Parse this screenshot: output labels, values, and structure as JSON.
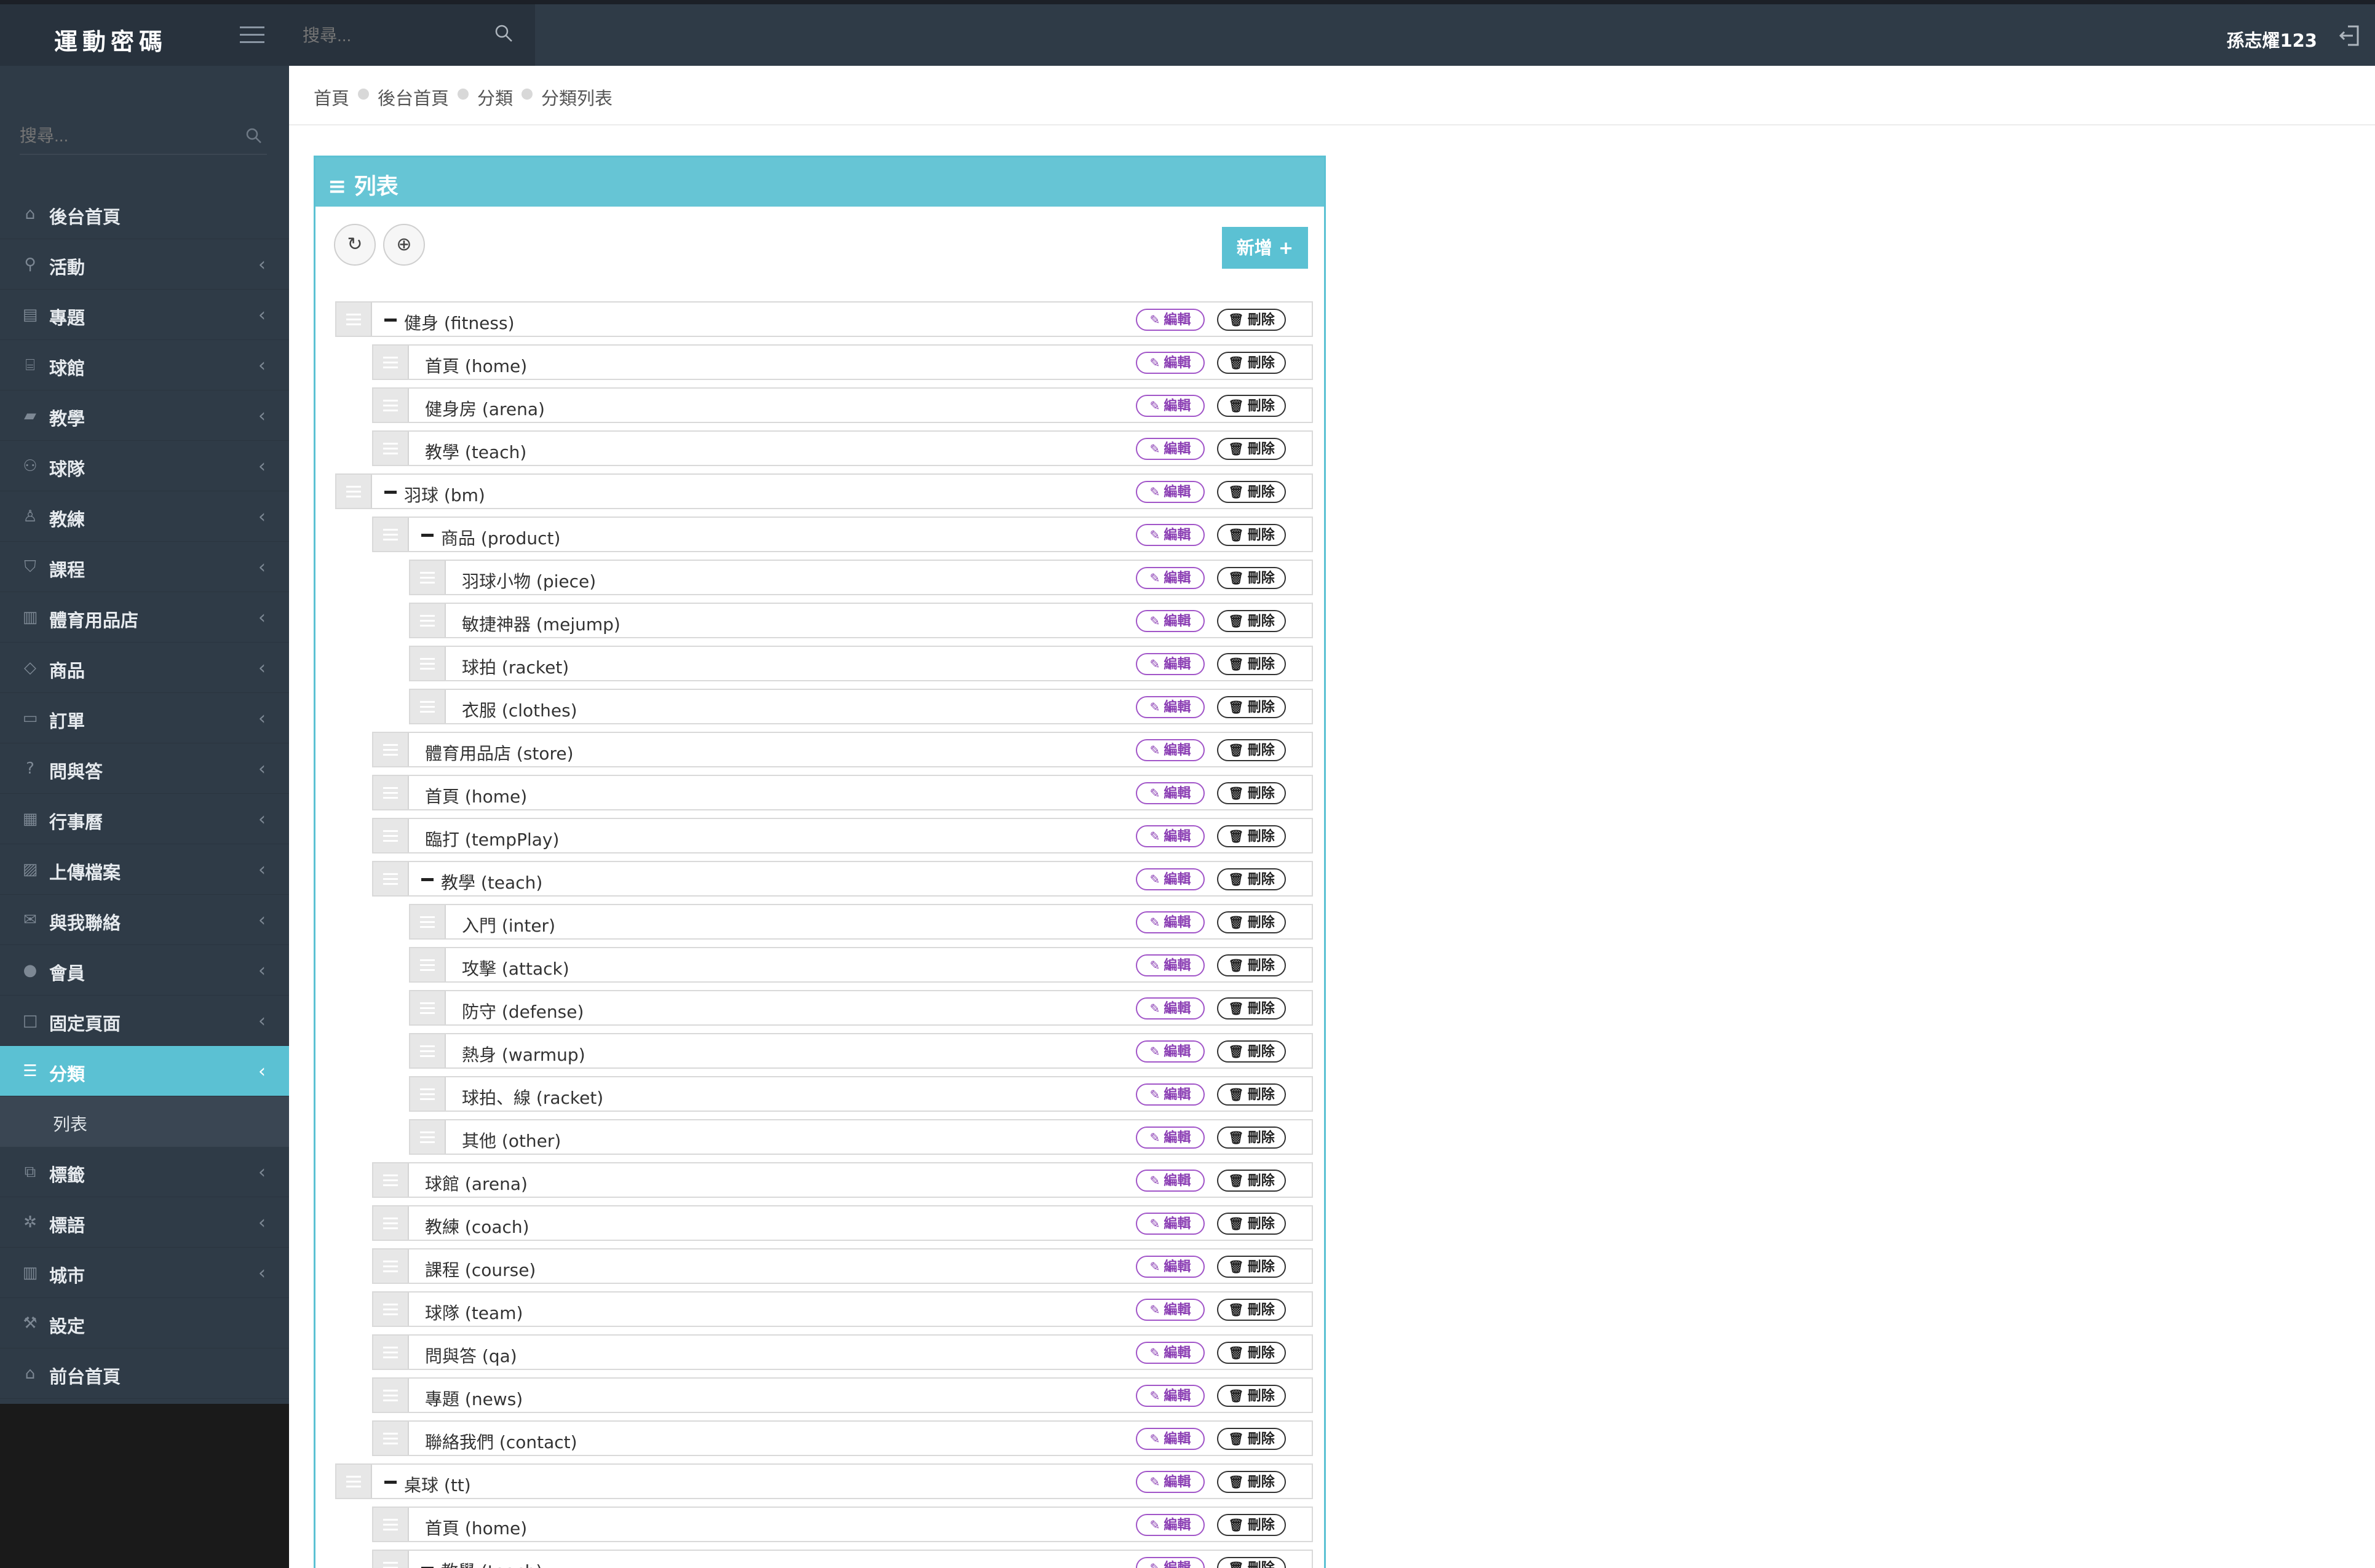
{
  "app": {
    "logo": "運動密碼",
    "search_placeholder": "搜尋...",
    "sidebar_search_placeholder": "搜尋...",
    "user_name": "孫志燿123"
  },
  "sidebar": {
    "items": [
      {
        "label": "後台首頁",
        "icon": "home-icon",
        "chevron": false
      },
      {
        "label": "活動",
        "icon": "bicycle-icon",
        "chevron": true
      },
      {
        "label": "專題",
        "icon": "newspaper-icon",
        "chevron": true
      },
      {
        "label": "球館",
        "icon": "bank-icon",
        "chevron": true
      },
      {
        "label": "教學",
        "icon": "book-icon",
        "chevron": true
      },
      {
        "label": "球隊",
        "icon": "users-icon",
        "chevron": true
      },
      {
        "label": "教練",
        "icon": "person-icon",
        "chevron": true
      },
      {
        "label": "課程",
        "icon": "graduation-cap-icon",
        "chevron": true
      },
      {
        "label": "體育用品店",
        "icon": "building-icon",
        "chevron": true
      },
      {
        "label": "商品",
        "icon": "diamond-icon",
        "chevron": true
      },
      {
        "label": "訂單",
        "icon": "desktop-icon",
        "chevron": true
      },
      {
        "label": "問與答",
        "icon": "question-icon",
        "chevron": true
      },
      {
        "label": "行事曆",
        "icon": "calendar-icon",
        "chevron": true
      },
      {
        "label": "上傳檔案",
        "icon": "image-icon",
        "chevron": true
      },
      {
        "label": "與我聯絡",
        "icon": "envelope-icon",
        "chevron": true
      },
      {
        "label": "會員",
        "icon": "user-icon",
        "chevron": true
      },
      {
        "label": "固定頁面",
        "icon": "square-icon",
        "chevron": true
      },
      {
        "label": "分類",
        "icon": "list-icon",
        "chevron": true,
        "active": true
      },
      {
        "label": "標籤",
        "icon": "tags-icon",
        "chevron": true
      },
      {
        "label": "標語",
        "icon": "gear-icon",
        "chevron": true
      },
      {
        "label": "城市",
        "icon": "building-icon",
        "chevron": true
      },
      {
        "label": "設定",
        "icon": "wrench-icon",
        "chevron": false
      },
      {
        "label": "前台首頁",
        "icon": "home-icon",
        "chevron": false
      }
    ],
    "submenu": {
      "label": "列表"
    }
  },
  "breadcrumb": [
    "首頁",
    "後台首頁",
    "分類",
    "分類列表"
  ],
  "panel": {
    "title": "列表",
    "add_label": "新增",
    "edit_label": "編輯",
    "delete_label": "刪除"
  },
  "tree": [
    {
      "label": "健身 (fitness)",
      "level": 0,
      "collapsible": true
    },
    {
      "label": "首頁 (home)",
      "level": 1,
      "collapsible": false
    },
    {
      "label": "健身房 (arena)",
      "level": 1,
      "collapsible": false
    },
    {
      "label": "教學 (teach)",
      "level": 1,
      "collapsible": false
    },
    {
      "label": "羽球 (bm)",
      "level": 0,
      "collapsible": true
    },
    {
      "label": "商品 (product)",
      "level": 1,
      "collapsible": true
    },
    {
      "label": "羽球小物 (piece)",
      "level": 2,
      "collapsible": false
    },
    {
      "label": "敏捷神器 (mejump)",
      "level": 2,
      "collapsible": false
    },
    {
      "label": "球拍 (racket)",
      "level": 2,
      "collapsible": false
    },
    {
      "label": "衣服 (clothes)",
      "level": 2,
      "collapsible": false
    },
    {
      "label": "體育用品店 (store)",
      "level": 1,
      "collapsible": false
    },
    {
      "label": "首頁 (home)",
      "level": 1,
      "collapsible": false
    },
    {
      "label": "臨打 (tempPlay)",
      "level": 1,
      "collapsible": false
    },
    {
      "label": "教學 (teach)",
      "level": 1,
      "collapsible": true
    },
    {
      "label": "入門 (inter)",
      "level": 2,
      "collapsible": false
    },
    {
      "label": "攻擊 (attack)",
      "level": 2,
      "collapsible": false
    },
    {
      "label": "防守 (defense)",
      "level": 2,
      "collapsible": false
    },
    {
      "label": "熱身 (warmup)",
      "level": 2,
      "collapsible": false
    },
    {
      "label": "球拍、線 (racket)",
      "level": 2,
      "collapsible": false
    },
    {
      "label": "其他 (other)",
      "level": 2,
      "collapsible": false
    },
    {
      "label": "球館 (arena)",
      "level": 1,
      "collapsible": false
    },
    {
      "label": "教練 (coach)",
      "level": 1,
      "collapsible": false
    },
    {
      "label": "課程 (course)",
      "level": 1,
      "collapsible": false
    },
    {
      "label": "球隊 (team)",
      "level": 1,
      "collapsible": false
    },
    {
      "label": "問與答 (qa)",
      "level": 1,
      "collapsible": false
    },
    {
      "label": "專題 (news)",
      "level": 1,
      "collapsible": false
    },
    {
      "label": "聯絡我們 (contact)",
      "level": 1,
      "collapsible": false
    },
    {
      "label": "桌球 (tt)",
      "level": 0,
      "collapsible": true
    },
    {
      "label": "首頁 (home)",
      "level": 1,
      "collapsible": false
    },
    {
      "label": "教學 (teach)",
      "level": 1,
      "collapsible": true
    }
  ],
  "colors": {
    "accent": "#5bc1d3",
    "sidebar_bg": "#2f3b47",
    "edit": "#a155c8"
  }
}
